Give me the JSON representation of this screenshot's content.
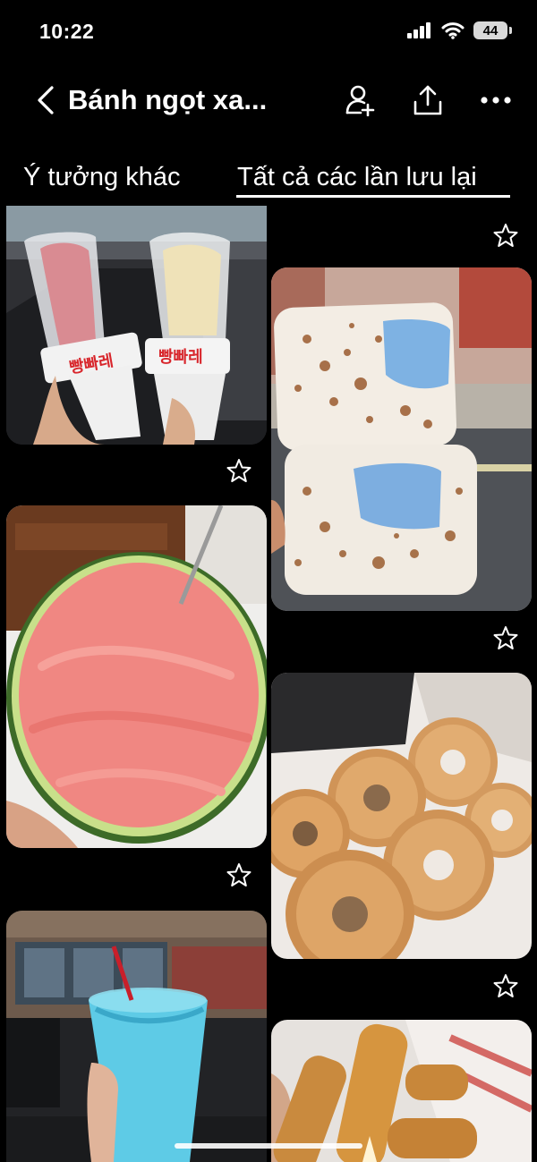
{
  "status_bar": {
    "time": "10:22",
    "battery": "44"
  },
  "header": {
    "title": "Bánh ngọt xa..."
  },
  "tabs": [
    {
      "label": "Ý tưởng khác",
      "active": false
    },
    {
      "label": "Tất cả các lần lưu lại",
      "active": true
    }
  ],
  "pins": [
    {
      "name": "pin-ice-cream-cones",
      "package_text": "빵빠레"
    },
    {
      "name": "pin-torched-marshmallow-ice-cream"
    },
    {
      "name": "pin-watermelon-sorbet"
    },
    {
      "name": "pin-glazed-donuts"
    },
    {
      "name": "pin-blue-slushie"
    },
    {
      "name": "pin-fried-cheese-sticks"
    }
  ],
  "colors": {
    "background": "#000000",
    "text": "#ffffff"
  }
}
